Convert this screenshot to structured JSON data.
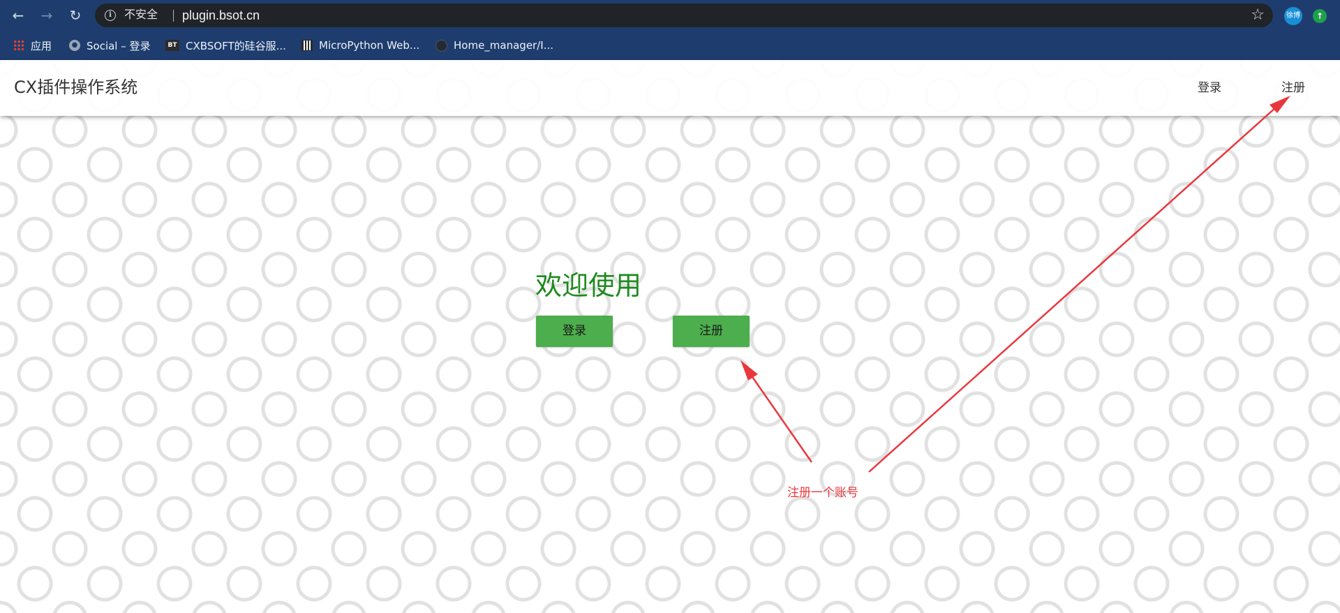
{
  "browser": {
    "security_label": "不安全",
    "url": "plugin.bsot.cn",
    "avatar_text": "徐博",
    "bookmarks": [
      {
        "label": "应用",
        "icon": "apps-grid-icon"
      },
      {
        "label": "Social – 登录",
        "icon": "globe-icon"
      },
      {
        "label": "CXBSOFT的硅谷服...",
        "icon": "bt-icon",
        "icon_text": "BT"
      },
      {
        "label": "MicroPython Web...",
        "icon": "micropython-icon"
      },
      {
        "label": "Home_manager/I...",
        "icon": "github-icon"
      }
    ]
  },
  "site": {
    "title": "CX插件操作系统",
    "nav": {
      "login": "登录",
      "register": "注册"
    }
  },
  "main": {
    "welcome": "欢迎使用",
    "login_button": "登录",
    "register_button": "注册"
  },
  "annotation": {
    "text": "注册一个账号",
    "color": "#e8383d"
  },
  "colors": {
    "chrome": "#1e3d6e",
    "button_green": "#4cae4c",
    "welcome_green": "#1f8a1f"
  }
}
